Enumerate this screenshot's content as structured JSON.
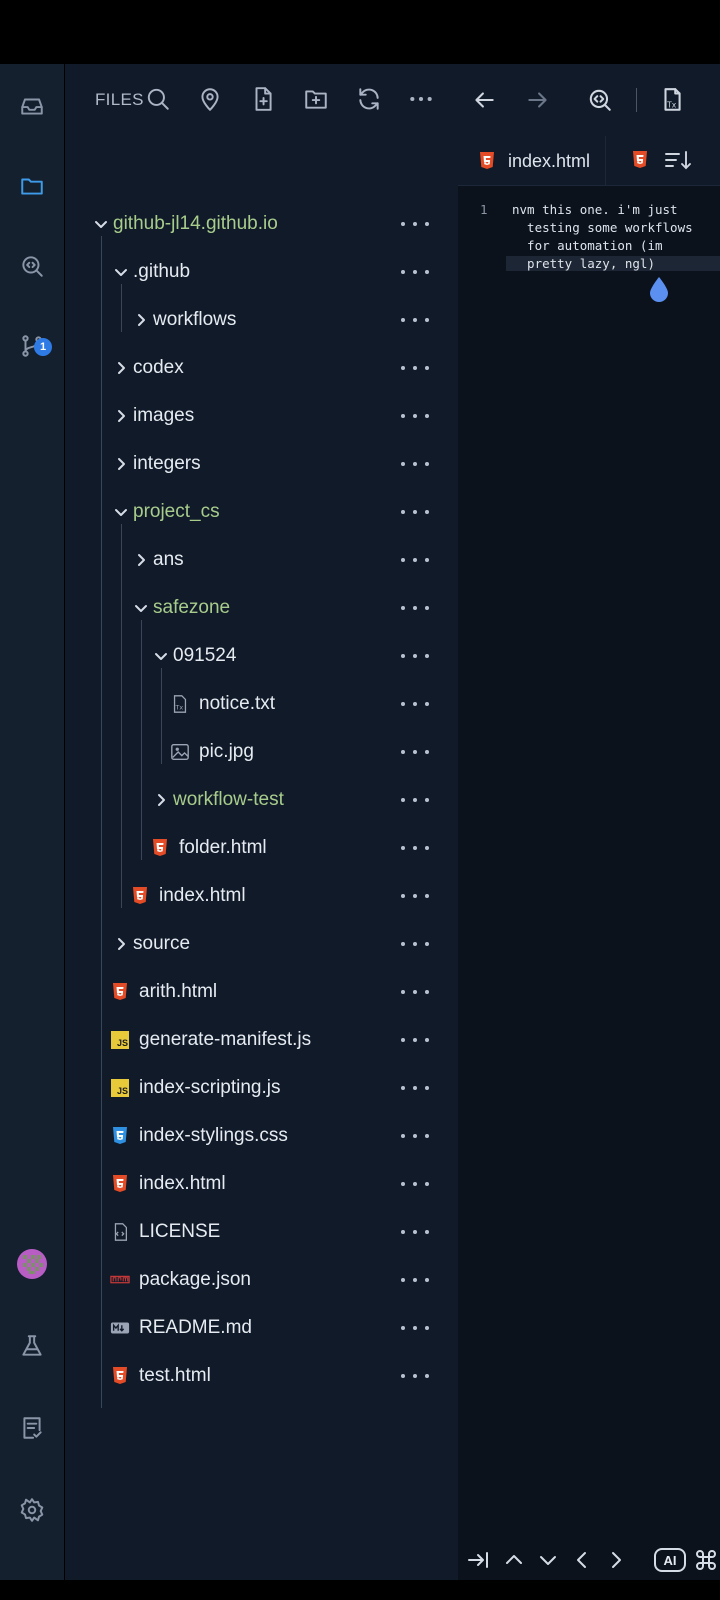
{
  "activity_bar": {
    "items": [
      "inbox-icon",
      "files-icon",
      "code-search-icon",
      "source-control-icon",
      "avatar",
      "flask-icon",
      "checklist-icon",
      "settings-icon"
    ],
    "source_control_badge": "1"
  },
  "explorer": {
    "title": "FILES",
    "header_icons": [
      "search-icon",
      "location-pin-icon",
      "new-file-icon",
      "new-folder-icon",
      "refresh-icon",
      "more-icon"
    ],
    "tree": [
      {
        "label": "github-jl14.github.io",
        "type": "folder",
        "open": true
      },
      {
        "label": ".github",
        "type": "folder",
        "open": true
      },
      {
        "label": "workflows",
        "type": "folder",
        "open": false
      },
      {
        "label": "codex",
        "type": "folder",
        "open": false
      },
      {
        "label": "images",
        "type": "folder",
        "open": false
      },
      {
        "label": "integers",
        "type": "folder",
        "open": false
      },
      {
        "label": "project_cs",
        "type": "folder",
        "open": true
      },
      {
        "label": "ans",
        "type": "folder",
        "open": false
      },
      {
        "label": "safezone",
        "type": "folder",
        "open": true
      },
      {
        "label": "091524",
        "type": "folder",
        "open": true
      },
      {
        "label": "notice.txt",
        "type": "txt"
      },
      {
        "label": "pic.jpg",
        "type": "image"
      },
      {
        "label": "workflow-test",
        "type": "folder",
        "open": false
      },
      {
        "label": "folder.html",
        "type": "html"
      },
      {
        "label": "index.html",
        "type": "html"
      },
      {
        "label": "source",
        "type": "folder",
        "open": false
      },
      {
        "label": "arith.html",
        "type": "html"
      },
      {
        "label": "generate-manifest.js",
        "type": "js"
      },
      {
        "label": "index-scripting.js",
        "type": "js"
      },
      {
        "label": "index-stylings.css",
        "type": "css"
      },
      {
        "label": "index.html",
        "type": "html"
      },
      {
        "label": "LICENSE",
        "type": "license"
      },
      {
        "label": "package.json",
        "type": "npm"
      },
      {
        "label": "README.md",
        "type": "md"
      },
      {
        "label": "test.html",
        "type": "html"
      }
    ]
  },
  "editor": {
    "tabs": [
      {
        "label": "index.html",
        "icon": "html5-icon"
      },
      {
        "label": "",
        "icon": "html5-icon"
      }
    ],
    "line_number": "1",
    "lines": [
      "nvm this one. i'm just",
      "  testing some workflows",
      "  for automation (im",
      "  pretty lazy, ngl)"
    ],
    "bottom_ai_label": "AI"
  },
  "colors": {
    "html5": "#e34c26",
    "js": "#e8c93a",
    "css3": "#2f8fe0",
    "npm": "#c33",
    "open_folder_text": "#a8cc8c",
    "accent": "#3d9be9"
  }
}
